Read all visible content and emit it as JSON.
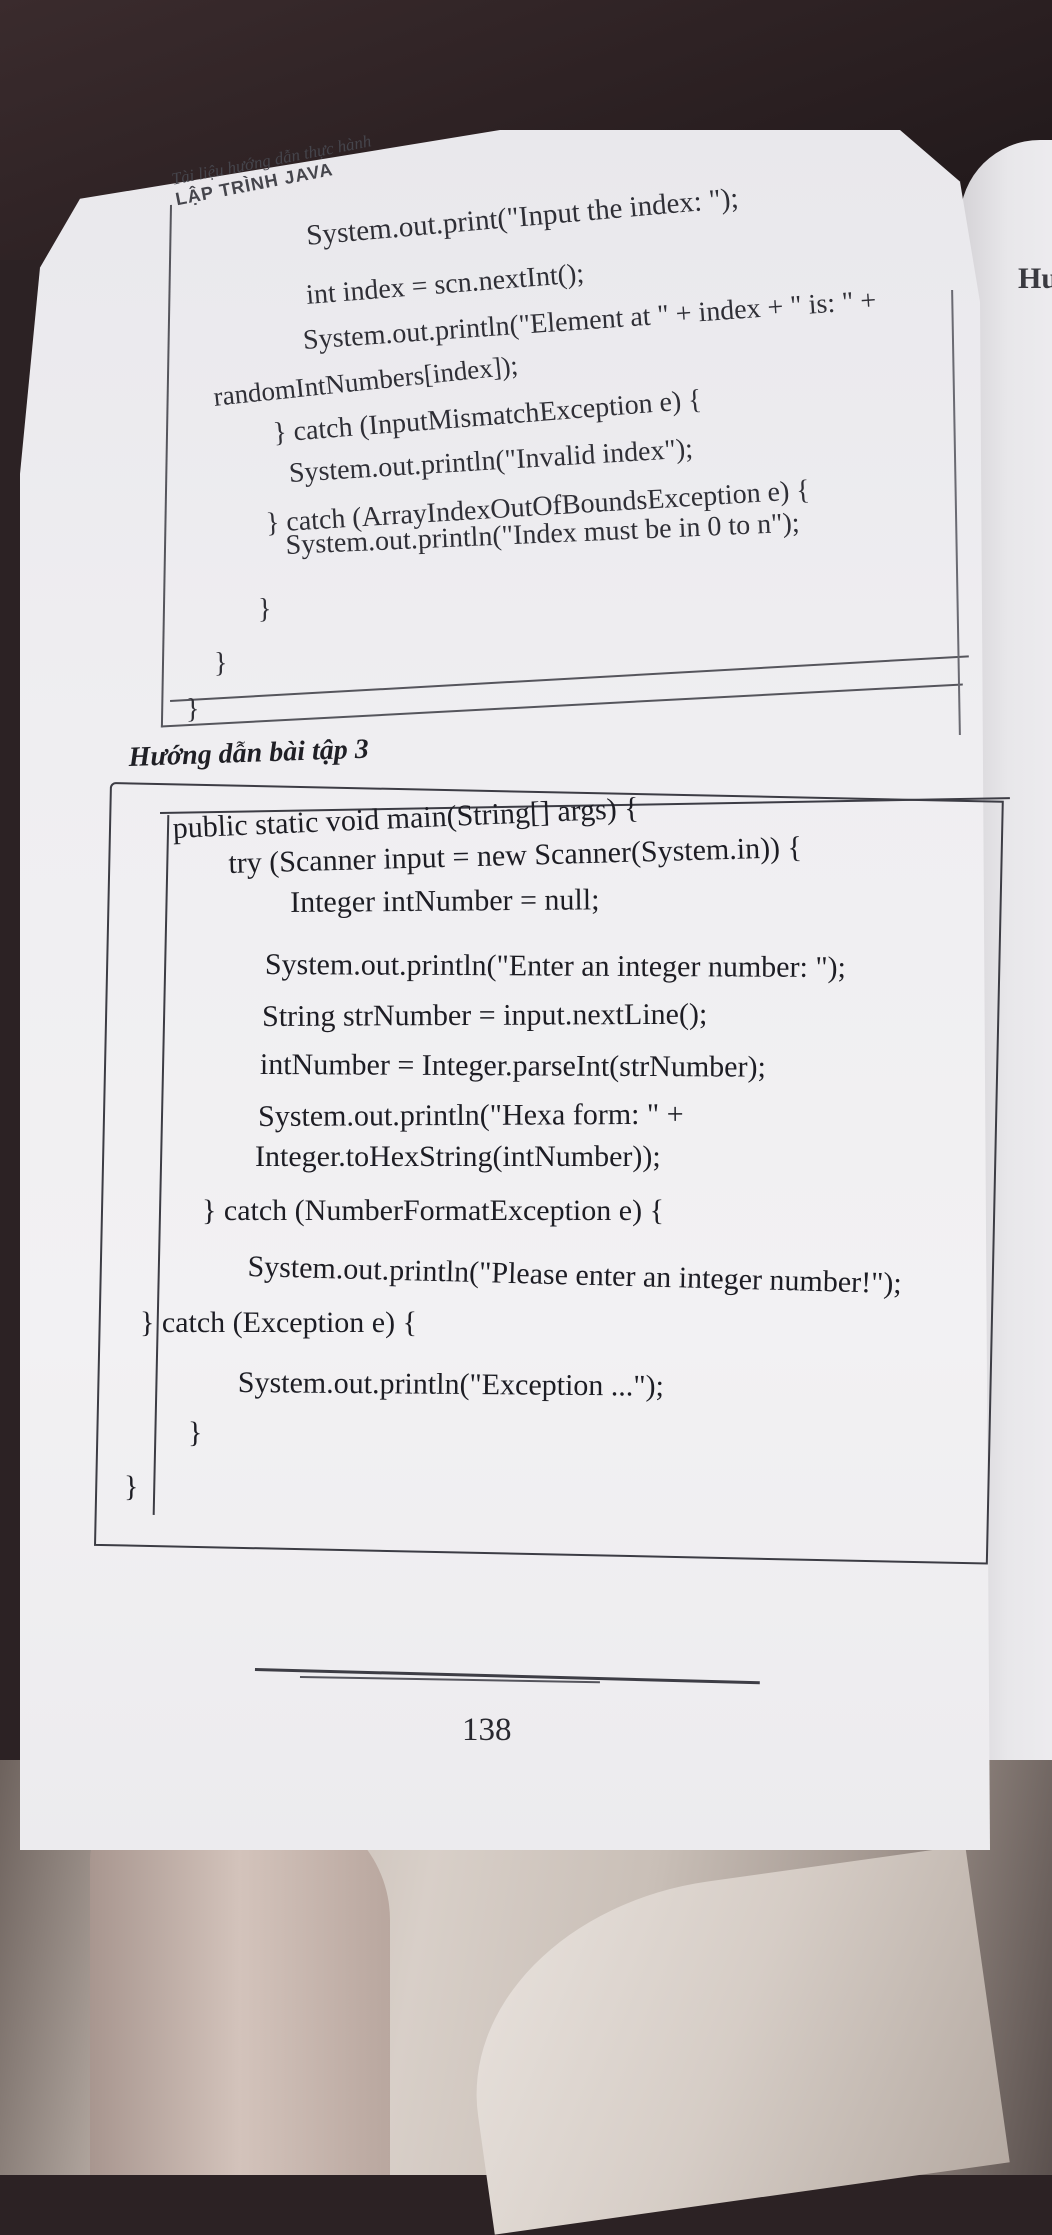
{
  "page": {
    "header_subtitle": "Tài liệu hướng dẫn thực hành",
    "header_title": "LẬP TRÌNH JAVA",
    "next_page_heading": "Hư",
    "page_number": "138"
  },
  "code_block_1": {
    "lines": [
      "System.out.print(\"Input the index: \");",
      "int index = scn.nextInt();",
      "System.out.println(\"Element at \" + index + \" is: \" +",
      "randomIntNumbers[index]);",
      "} catch (InputMismatchException e) {",
      "System.out.println(\"Invalid index\");",
      "} catch (ArrayIndexOutOfBoundsException e) {",
      "System.out.println(\"Index must be in 0 to n\");",
      "}",
      "}",
      "}"
    ]
  },
  "section": {
    "heading": "Hướng dẫn bài tập 3"
  },
  "code_block_2": {
    "lines": [
      "public static void main(String[] args) {",
      "try (Scanner input = new Scanner(System.in)) {",
      "Integer intNumber = null;",
      "System.out.println(\"Enter an integer number: \");",
      "String strNumber = input.nextLine();",
      "intNumber = Integer.parseInt(strNumber);",
      "System.out.println(\"Hexa form: \" +",
      "Integer.toHexString(intNumber));",
      "} catch (NumberFormatException e) {",
      "System.out.println(\"Please enter an integer number!\");",
      "} catch (Exception e) {",
      "System.out.println(\"Exception ...\");",
      "}",
      "}"
    ]
  }
}
